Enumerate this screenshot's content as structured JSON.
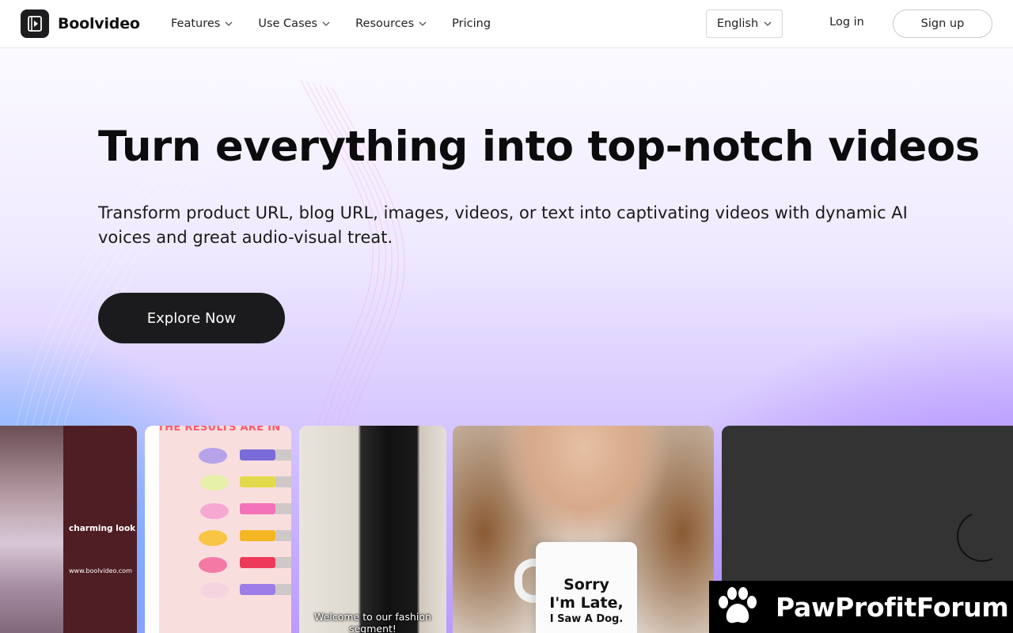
{
  "brand": {
    "name": "Boolvideo",
    "logo_icon": "play-frame-icon"
  },
  "nav": {
    "items": [
      {
        "label": "Features",
        "has_dropdown": true
      },
      {
        "label": "Use Cases",
        "has_dropdown": true
      },
      {
        "label": "Resources",
        "has_dropdown": true
      },
      {
        "label": "Pricing",
        "has_dropdown": false
      }
    ]
  },
  "header": {
    "language": "English",
    "login_label": "Log in",
    "signup_label": "Sign up"
  },
  "hero": {
    "title": "Turn everything into top-notch videos",
    "subtitle": "Transform product URL, blog URL, images, videos, or text into captivating videos with dynamic AI voices and great audio-visual treat.",
    "cta_label": "Explore Now"
  },
  "cards": [
    {
      "caption": "charming look",
      "url": "www.boolvideo.com"
    },
    {
      "caption": "THE RESULTS ARE IN"
    },
    {
      "caption": "Welcome to our fashion segment!"
    },
    {
      "mug_lines": [
        "Sorry",
        "I'm Late,",
        "I Saw A Dog."
      ]
    },
    {
      "state": "loading"
    }
  ],
  "watermark": {
    "text": "PawProfitForum",
    "icon": "paw-icon"
  },
  "colors": {
    "header_bg": "#ffffff",
    "cta_bg": "#1b1b1d",
    "hero_gradient_left": "#3caaff",
    "hero_gradient_right": "#9664ff",
    "card1_bg": "#4f1d24",
    "card5_bg": "#333334"
  }
}
